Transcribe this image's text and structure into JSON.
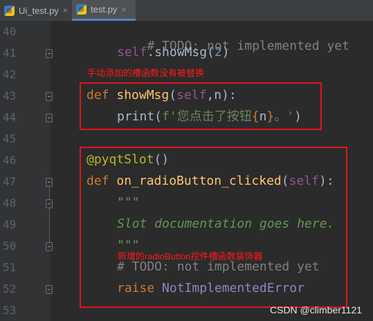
{
  "tabs": [
    {
      "label": "Ui_test.py",
      "close": "×"
    },
    {
      "label": "test.py",
      "close": "×"
    }
  ],
  "line_numbers": [
    "40",
    "41",
    "42",
    "43",
    "44",
    "45",
    "46",
    "47",
    "48",
    "49",
    "50",
    "51",
    "52",
    "53"
  ],
  "code": {
    "l40": "# TODO: not implemented yet",
    "l41_self": "self",
    "l41_dot": ".showMsg(",
    "l41_num": "2",
    "l41_close": ")",
    "l43_def": "def ",
    "l43_fn": "showMsg",
    "l43_open": "(",
    "l43_self": "self",
    "l43_rest": ",n):",
    "l44_print": "print(",
    "l44_f": "f'您点击了按钮",
    "l44_br1": "{",
    "l44_n": "n",
    "l44_br2": "}",
    "l44_tail": "。'",
    "l44_close": ")",
    "l46_deco": "@pyqtSlot",
    "l46_paren": "()",
    "l47_def": "def ",
    "l47_fn": "on_radioButton_clicked",
    "l47_open": "(",
    "l47_self": "self",
    "l47_close": "):",
    "l48": "\"\"\"",
    "l49": "Slot documentation goes here.",
    "l50": "\"\"\"",
    "l51": "# TODO: not implemented yet",
    "l52_kw": "raise ",
    "l52_cls": "NotImplementedError"
  },
  "annotations": {
    "note1": "手动添加的槽函数没有被替换",
    "note2": "新增的radioButton控件槽函数装饰器"
  },
  "watermark": "CSDN @climber1121",
  "colors": {
    "background": "#2b2b2b",
    "keyword": "#cc7832",
    "function": "#ffc66d",
    "self": "#94558d",
    "comment": "#808080",
    "docstring": "#629755",
    "decorator": "#bbb529",
    "annotation": "#ff1a1a"
  },
  "icons": [
    "python-file-icon",
    "close-icon",
    "fold-marker-icon"
  ]
}
